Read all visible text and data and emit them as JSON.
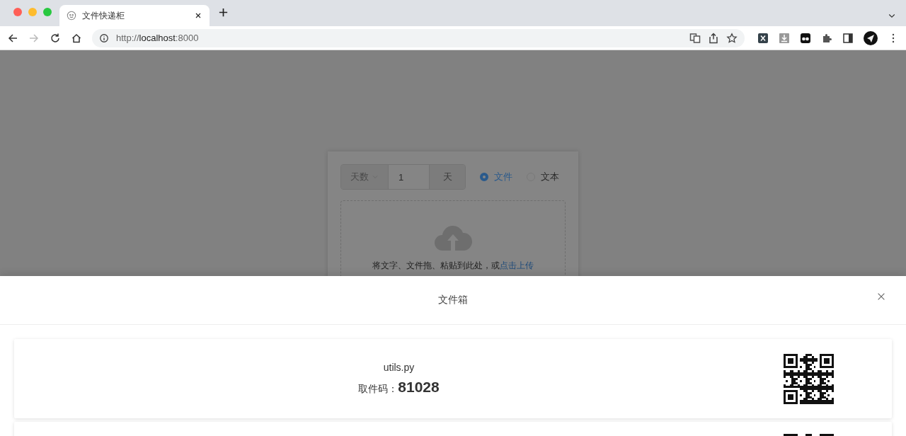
{
  "browser": {
    "tab_title": "文件快递柜",
    "url_scheme": "http://",
    "url_host": "localhost",
    "url_port": ":8000"
  },
  "form": {
    "expire_unit_select": "天数",
    "expire_value": "1",
    "expire_suffix": "天",
    "types": [
      {
        "label": "文件",
        "selected": true
      },
      {
        "label": "文本",
        "selected": false
      }
    ],
    "upload_hint": "将文字、文件拖、粘贴到此处，或",
    "upload_link": "点击上传"
  },
  "drawer": {
    "title": "文件箱",
    "cards": [
      {
        "kind": "full",
        "name": "utils.py",
        "code_label": "取件码：",
        "code": "81028"
      },
      {
        "kind": "partial"
      }
    ]
  }
}
